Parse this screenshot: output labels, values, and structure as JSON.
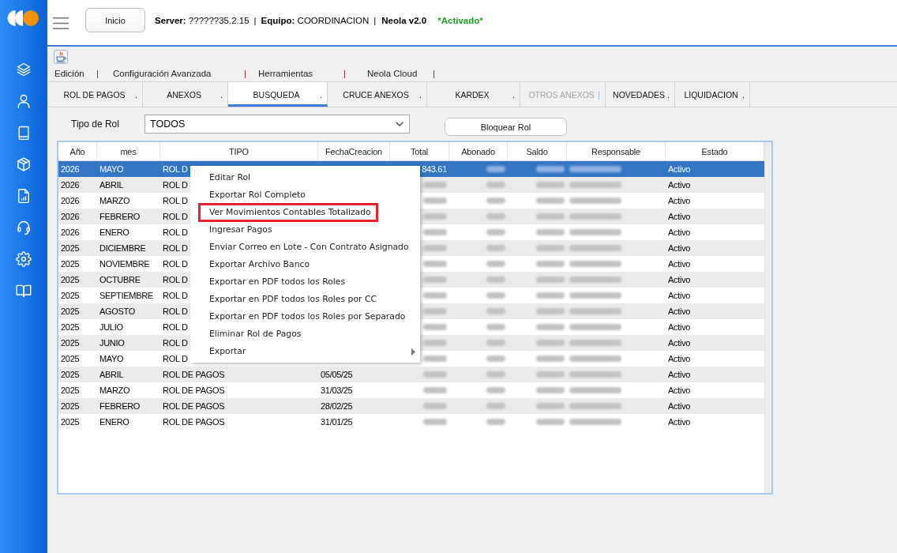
{
  "header": {
    "home_button": "Inicio",
    "info": [
      {
        "text": "**Server:** ??????35.2.15",
        "separator": "|"
      },
      {
        "text": "**Equipo:** COORDINACION",
        "separator": "|"
      }
    ],
    "version": "Neola v2.0",
    "activation": "*Activado*"
  },
  "menu_bar": [
    {
      "label": "Edición",
      "separator": "|"
    },
    {
      "label": "Configuración Avanzada",
      "separator": "|"
    },
    {
      "label": "Herramientas",
      "separator": "|"
    },
    {
      "label": "Neola Cloud",
      "separator": "|"
    }
  ],
  "tabs": [
    {
      "label": "ROL DE PAGOS",
      "suffix": ".",
      "selected": false,
      "disabled": false
    },
    {
      "label": "ANEXOS",
      "suffix": ".",
      "selected": false,
      "disabled": false
    },
    {
      "label": "BUSQUEDA",
      "suffix": ".",
      "selected": true,
      "disabled": false
    },
    {
      "label": "CRUCE ANEXOS",
      "suffix": ".",
      "selected": false,
      "disabled": false
    },
    {
      "label": "KARDEX",
      "suffix": ".",
      "selected": false,
      "disabled": false
    },
    {
      "label": "OTROS ANEXOS",
      "suffix": "|",
      "selected": false,
      "disabled": true
    },
    {
      "label": "NOVEDADES",
      "suffix": ".",
      "selected": false,
      "disabled": false
    },
    {
      "label": "LIQUIDACION",
      "suffix": ".",
      "selected": false,
      "disabled": false
    }
  ],
  "filter": {
    "label": "Tipo de Rol",
    "value": "TODOS"
  },
  "lock_button": "Bloquear Rol",
  "table": {
    "columns": [
      {
        "label": "Año",
        "blurred": false
      },
      {
        "label": "mes",
        "blurred": false
      },
      {
        "label": "TIPO",
        "blurred": false
      },
      {
        "label": "FechaCreacion",
        "blurred": false
      },
      {
        "label": "Total",
        "blurred": true
      },
      {
        "label": "Abonado",
        "blurred": true
      },
      {
        "label": "Saldo",
        "blurred": true
      },
      {
        "label": "Responsable",
        "blurred": true
      },
      {
        "label": "Estado",
        "blurred": false
      }
    ],
    "rows": [
      {
        "year": "2026",
        "month": "MAYO",
        "type": "ROL D",
        "total": "843.61",
        "status": "Activo",
        "selected": true
      },
      {
        "year": "2026",
        "month": "ABRIL",
        "type": "ROL D",
        "status": "Activo",
        "selected": false
      },
      {
        "year": "2026",
        "month": "MARZO",
        "type": "ROL D",
        "status": "Activo",
        "selected": false
      },
      {
        "year": "2026",
        "month": "FEBRERO",
        "type": "ROL D",
        "status": "Activo",
        "selected": false
      },
      {
        "year": "2026",
        "month": "ENERO",
        "type": "ROL D",
        "status": "Activo",
        "selected": false
      },
      {
        "year": "2025",
        "month": "DICIEMBRE",
        "type": "ROL D",
        "status": "Activo",
        "selected": false
      },
      {
        "year": "2025",
        "month": "NOVIEMBRE",
        "type": "ROL D",
        "status": "Activo",
        "selected": false
      },
      {
        "year": "2025",
        "month": "OCTUBRE",
        "type": "ROL D",
        "status": "Activo",
        "selected": false
      },
      {
        "year": "2025",
        "month": "SEPTIEMBRE",
        "type": "ROL D",
        "status": "Activo",
        "selected": false
      },
      {
        "year": "2025",
        "month": "AGOSTO",
        "type": "ROL D",
        "status": "Activo",
        "selected": false
      },
      {
        "year": "2025",
        "month": "JULIO",
        "type": "ROL D",
        "status": "Activo",
        "selected": false
      },
      {
        "year": "2025",
        "month": "JUNIO",
        "type": "ROL D",
        "status": "Activo",
        "selected": false
      },
      {
        "year": "2025",
        "month": "MAYO",
        "type": "ROL D",
        "status": "Activo",
        "selected": false
      },
      {
        "year": "2025",
        "month": "ABRIL",
        "type": "ROL DE PAGOS",
        "created": "05/05/25",
        "status": "Activo",
        "selected": false
      },
      {
        "year": "2025",
        "month": "MARZO",
        "type": "ROL DE PAGOS",
        "created": "31/03/25",
        "status": "Activo",
        "selected": false
      },
      {
        "year": "2025",
        "month": "FEBRERO",
        "type": "ROL DE PAGOS",
        "created": "28/02/25",
        "status": "Activo",
        "selected": false
      },
      {
        "year": "2025",
        "month": "ENERO",
        "type": "ROL DE PAGOS",
        "created": "31/01/25",
        "status": "Activo",
        "selected": false
      }
    ]
  },
  "context_menu": {
    "items": [
      {
        "label": "Editar Rol",
        "highlighted": false,
        "submenu": false
      },
      {
        "label": "Exportar Rol Completo",
        "highlighted": false,
        "submenu": false
      },
      {
        "label": "Ver Movimientos Contables Totalizado",
        "highlighted": true,
        "submenu": false
      },
      {
        "label": "Ingresar Pagos",
        "highlighted": false,
        "submenu": false
      },
      {
        "label": "Enviar Correo en Lote - Con Contrato Asignado",
        "highlighted": false,
        "submenu": false
      },
      {
        "label": "Exportar Archivo Banco",
        "highlighted": false,
        "submenu": false
      },
      {
        "label": "Exportar en PDF todos los Roles",
        "highlighted": false,
        "submenu": false
      },
      {
        "label": "Exportar en PDF todos los Roles por CC",
        "highlighted": false,
        "submenu": false
      },
      {
        "label": "Exportar en PDF todos los Roles por Separado",
        "highlighted": false,
        "submenu": false
      },
      {
        "label": "Eliminar Rol de Pagos",
        "highlighted": false,
        "submenu": false
      },
      {
        "label": "Exportar",
        "highlighted": false,
        "submenu": true
      }
    ]
  }
}
